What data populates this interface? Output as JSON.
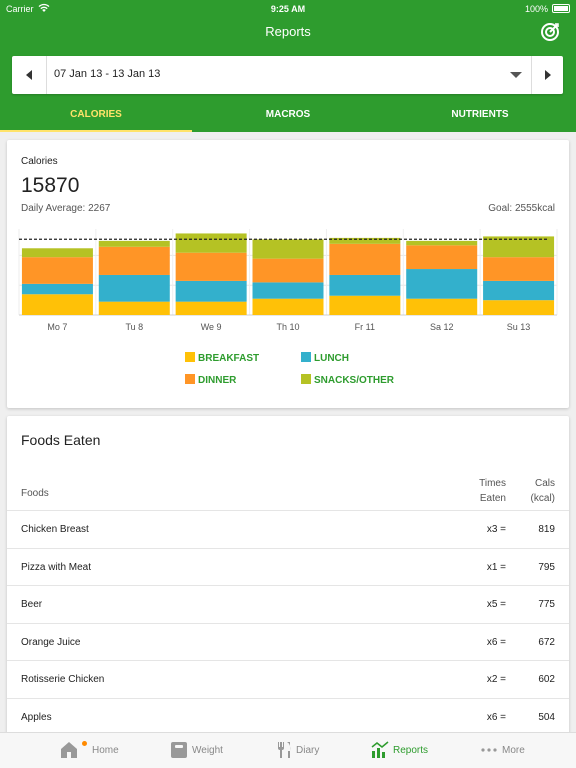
{
  "status_bar": {
    "carrier": "Carrier",
    "time": "9:25 AM",
    "battery": "100%"
  },
  "header": {
    "title": "Reports"
  },
  "date_range": {
    "label": "07 Jan 13 - 13 Jan 13"
  },
  "tabs": [
    {
      "label": "CALORIES",
      "active": true
    },
    {
      "label": "MACROS",
      "active": false
    },
    {
      "label": "NUTRIENTS",
      "active": false
    }
  ],
  "calories": {
    "label": "Calories",
    "total": "15870",
    "daily_average": "Daily Average: 2267",
    "goal": "Goal: 2555kcal"
  },
  "chart_data": {
    "type": "bar",
    "stacked": true,
    "categories": [
      "Mo 7",
      "Tu 8",
      "We 9",
      "Th 10",
      "Fr 11",
      "Sa 12",
      "Su 13"
    ],
    "goal_line": 2555,
    "ylim": [
      0,
      2900
    ],
    "grid": true,
    "series": [
      {
        "name": "BREAKFAST",
        "color": "#ffc107",
        "values": [
          700,
          450,
          450,
          550,
          650,
          550,
          500
        ]
      },
      {
        "name": "LUNCH",
        "color": "#33b0cc",
        "values": [
          350,
          900,
          700,
          550,
          700,
          1000,
          650
        ]
      },
      {
        "name": "DINNER",
        "color": "#ff9526",
        "values": [
          900,
          950,
          950,
          800,
          1050,
          800,
          800
        ]
      },
      {
        "name": "SNACKS/OTHER",
        "color": "#b5c224",
        "values": [
          300,
          200,
          650,
          650,
          200,
          150,
          700
        ]
      }
    ]
  },
  "foods": {
    "title": "Foods Eaten",
    "headers": {
      "foods": "Foods",
      "times": [
        "Times",
        "Eaten"
      ],
      "cals": [
        "Cals",
        "(kcal)"
      ]
    },
    "rows": [
      {
        "name": "Chicken Breast",
        "times": "x3 =",
        "cals": "819"
      },
      {
        "name": "Pizza with Meat",
        "times": "x1 =",
        "cals": "795"
      },
      {
        "name": "Beer",
        "times": "x5 =",
        "cals": "775"
      },
      {
        "name": "Orange Juice",
        "times": "x6 =",
        "cals": "672"
      },
      {
        "name": "Rotisserie Chicken",
        "times": "x2 =",
        "cals": "602"
      },
      {
        "name": "Apples",
        "times": "x6 =",
        "cals": "504"
      }
    ]
  },
  "bottom_nav": [
    {
      "label": "Home",
      "icon": "home-icon",
      "active": false
    },
    {
      "label": "Weight",
      "icon": "scale-icon",
      "active": false
    },
    {
      "label": "Diary",
      "icon": "fork-knife-icon",
      "active": false
    },
    {
      "label": "Reports",
      "icon": "chart-icon",
      "active": true
    },
    {
      "label": "More",
      "icon": "more-icon",
      "active": false
    }
  ],
  "colors": {
    "brand": "#2e9c2e",
    "active_tab": "#ffe36a",
    "notification_dot": "#ff8a00"
  }
}
